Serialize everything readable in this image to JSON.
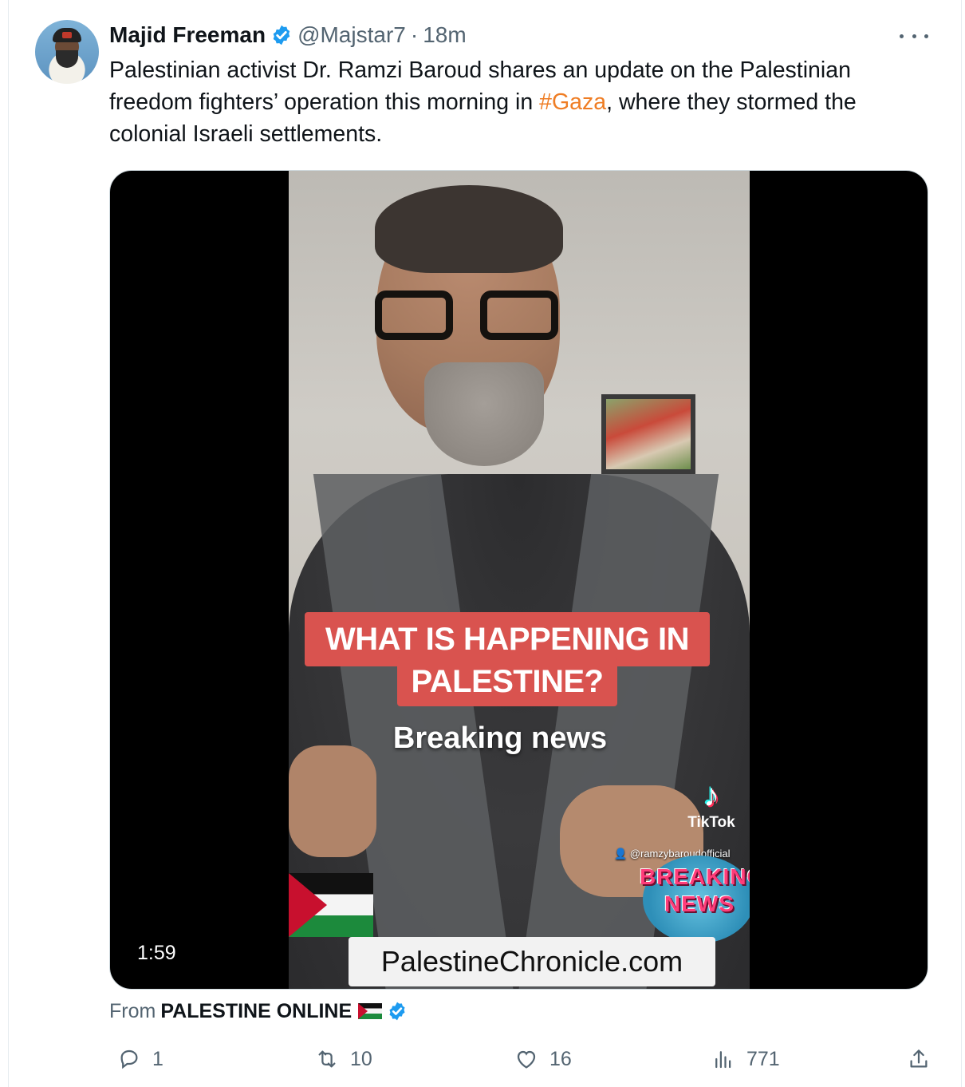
{
  "tweet": {
    "author_name": "Majid Freeman",
    "handle": "@Majstar7",
    "separator": "·",
    "time": "18m",
    "text_part1": "Palestinian activist Dr. Ramzi Baroud shares an update on the Palestinian freedom fighters’ operation this morning in ",
    "hashtag": "#Gaza",
    "text_part2": ", where they stormed the colonial Israeli settlements.",
    "hashtag_color": "#ef7d24",
    "verified_color": "#1d9bf0"
  },
  "media": {
    "caption_line1": "WHAT IS HAPPENING IN",
    "caption_line2": "PALESTINE?",
    "subtitle": "Breaking news",
    "tiktok_label": "TikTok",
    "tiktok_handle": "👤 @ramzybaroudofficial",
    "badge_line1": "BREAKING",
    "badge_line2": "NEWS",
    "site_banner": "PalestineChronicle.com",
    "duration": "1:59"
  },
  "source": {
    "prefix": "From",
    "name": "PALESTINE ONLINE"
  },
  "actions": {
    "replies": "1",
    "retweets": "10",
    "likes": "16",
    "views": "771"
  }
}
